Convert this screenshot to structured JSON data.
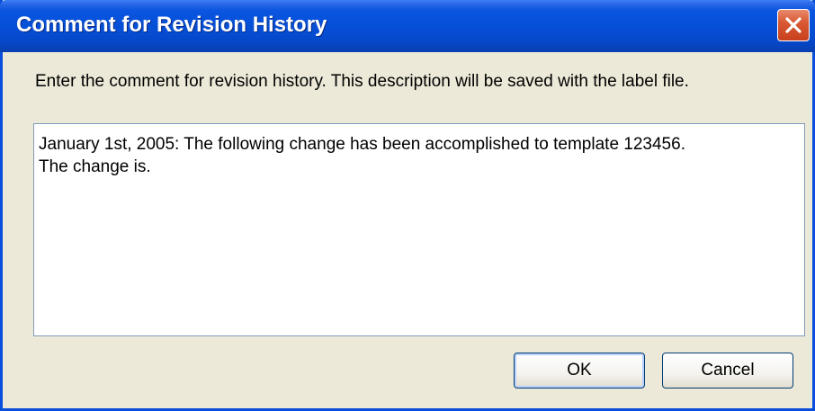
{
  "dialog": {
    "title": "Comment for Revision History",
    "description": "Enter the comment for revision history. This description will be saved with the label file.",
    "comment_value": "January 1st, 2005: The following change has been accomplished to template 123456.\nThe change is.",
    "ok_label": "OK",
    "cancel_label": "Cancel",
    "close_icon": "close-icon"
  },
  "colors": {
    "titlebar": "#0650d8",
    "window_body": "#ece9d8",
    "close_button": "#d95a34",
    "input_border": "#7f9db9"
  }
}
